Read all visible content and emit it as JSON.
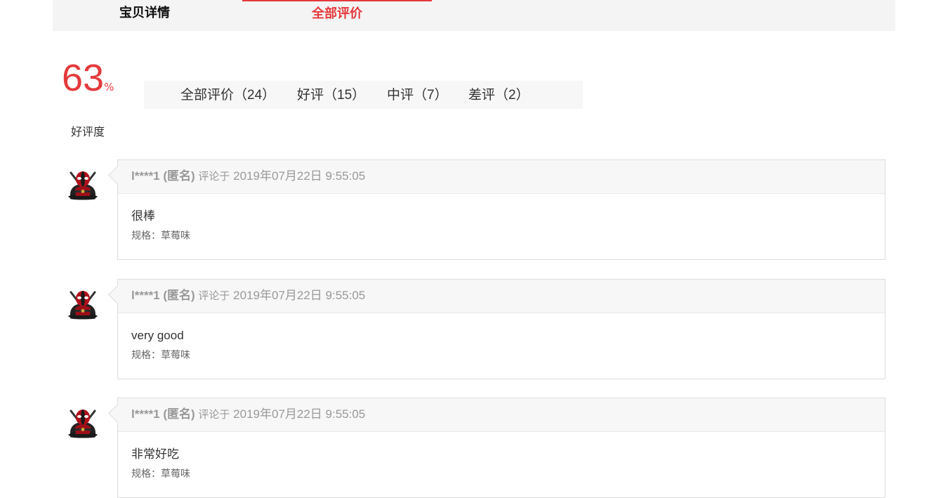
{
  "tabs": {
    "details": "宝贝详情",
    "reviews": "全部评价"
  },
  "rating": {
    "value": "63",
    "unit": "%",
    "label": "好评度"
  },
  "filters": [
    {
      "label": "全部评价（24）"
    },
    {
      "label": "好评（15）"
    },
    {
      "label": "中评（7）"
    },
    {
      "label": "差评（2）"
    }
  ],
  "reviews": [
    {
      "user": "l****1 (匿名)",
      "label": "评论于",
      "date": "2019年07月22日 9:55:05",
      "content": "很棒",
      "spec": "规格：草莓味",
      "avatar": "deadpool-avatar"
    },
    {
      "user": "l****1 (匿名)",
      "label": "评论于",
      "date": "2019年07月22日 9:55:05",
      "content": "very good",
      "spec": "规格：草莓味",
      "avatar": "deadpool-avatar"
    },
    {
      "user": "l****1 (匿名)",
      "label": "评论于",
      "date": "2019年07月22日 9:55:05",
      "content": "非常好吃",
      "spec": "规格：草莓味",
      "avatar": "deadpool-avatar"
    }
  ],
  "colors": {
    "accent": "#e4393c",
    "panel": "#f7f7f7",
    "border": "#dddddd"
  }
}
